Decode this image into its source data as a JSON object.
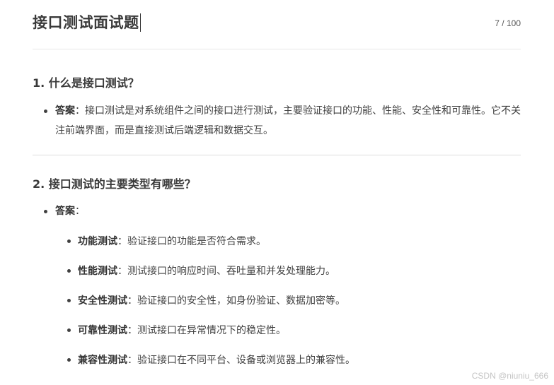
{
  "document": {
    "title": "接口测试面试题",
    "page_counter": "7 / 100"
  },
  "questions": [
    {
      "heading": "1. 什么是接口测试？",
      "answer_label": "答案",
      "answer_sep": "：",
      "answer_text": "接口测试是对系统组件之间的接口进行测试，主要验证接口的功能、性能、安全性和可靠性。它不关注前端界面，而是直接测试后端逻辑和数据交互。"
    },
    {
      "heading": "2. 接口测试的主要类型有哪些？",
      "answer_label": "答案",
      "answer_sep": "：",
      "items": [
        {
          "label": "功能测试",
          "sep": "：",
          "text": "验证接口的功能是否符合需求。"
        },
        {
          "label": "性能测试",
          "sep": "：",
          "text": "测试接口的响应时间、吞吐量和并发处理能力。"
        },
        {
          "label": "安全性测试",
          "sep": "：",
          "text": "验证接口的安全性，如身份验证、数据加密等。"
        },
        {
          "label": "可靠性测试",
          "sep": "：",
          "text": "测试接口在异常情况下的稳定性。"
        },
        {
          "label": "兼容性测试",
          "sep": "：",
          "text": "验证接口在不同平台、设备或浏览器上的兼容性。"
        }
      ]
    }
  ],
  "watermark": "CSDN @niuniu_666"
}
